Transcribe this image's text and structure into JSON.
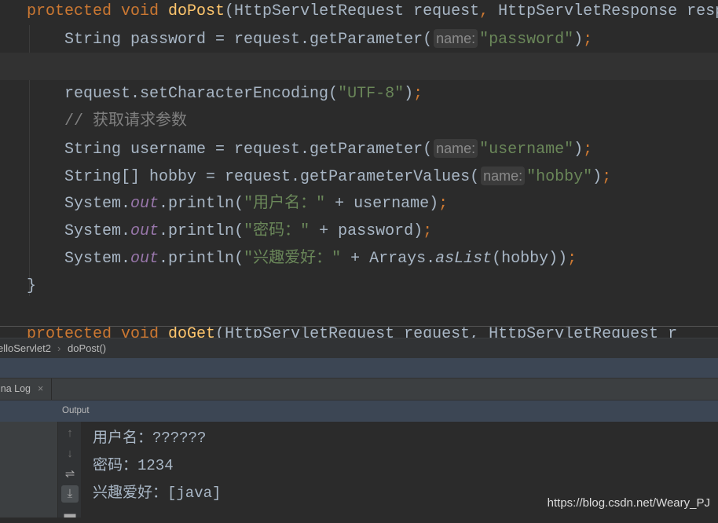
{
  "editor": {
    "lines": [
      [
        [
          "kw",
          "protected void "
        ],
        [
          "fn",
          "doPost"
        ],
        [
          "p",
          "(HttpServletRequest request"
        ],
        [
          "kw",
          ", "
        ],
        [
          "p",
          "HttpServletResponse resp"
        ]
      ],
      [
        [
          "p",
          "    String password = request.getParameter("
        ],
        [
          "hint",
          "name:"
        ],
        [
          "str",
          "\"password\""
        ],
        [
          "p",
          ")"
        ],
        [
          "kw",
          ";"
        ]
      ],
      [],
      [
        [
          "p",
          "    request.setCharacterEncoding("
        ],
        [
          "str",
          "\"UTF-8\""
        ],
        [
          "p",
          ")"
        ],
        [
          "kw",
          ";"
        ]
      ],
      [
        [
          "cm",
          "    // 获取请求参数"
        ]
      ],
      [
        [
          "p",
          "    String username = request.getParameter("
        ],
        [
          "hint",
          "name:"
        ],
        [
          "str",
          "\"username\""
        ],
        [
          "p",
          ")"
        ],
        [
          "kw",
          ";"
        ]
      ],
      [
        [
          "p",
          "    String[] hobby = request.getParameterValues("
        ],
        [
          "hint",
          "name:"
        ],
        [
          "str",
          "\"hobby\""
        ],
        [
          "p",
          ")"
        ],
        [
          "kw",
          ";"
        ]
      ],
      [
        [
          "p",
          "    System."
        ],
        [
          "fld",
          "out"
        ],
        [
          "p",
          ".println("
        ],
        [
          "str",
          "\"用户名：\""
        ],
        [
          "p",
          " + username)"
        ],
        [
          "kw",
          ";"
        ]
      ],
      [
        [
          "p",
          "    System."
        ],
        [
          "fld",
          "out"
        ],
        [
          "p",
          ".println("
        ],
        [
          "str",
          "\"密码：\""
        ],
        [
          "p",
          " + password)"
        ],
        [
          "kw",
          ";"
        ]
      ],
      [
        [
          "p",
          "    System."
        ],
        [
          "fld",
          "out"
        ],
        [
          "p",
          ".println("
        ],
        [
          "str",
          "\"兴趣爱好：\""
        ],
        [
          "p",
          " + Arrays."
        ],
        [
          "st",
          "asList"
        ],
        [
          "p",
          "(hobby))"
        ],
        [
          "kw",
          ";"
        ]
      ],
      [
        [
          "p",
          "}"
        ]
      ]
    ],
    "peek": [
      [
        "kw",
        "  protected void "
      ],
      [
        "fn",
        "doGet"
      ],
      [
        "p",
        "(HttpServletRequest request, HttpServletRequest r"
      ]
    ]
  },
  "breadcrumb": {
    "class": "elloServlet2",
    "sep": "›",
    "method": "doPost()"
  },
  "tab": {
    "label": "ina Log",
    "close": "×"
  },
  "output": {
    "title": "Output",
    "lines": [
      "用户名：??????",
      "密码：1234",
      "兴趣爱好：[java]"
    ]
  },
  "watermark": "https://blog.csdn.net/Weary_PJ"
}
